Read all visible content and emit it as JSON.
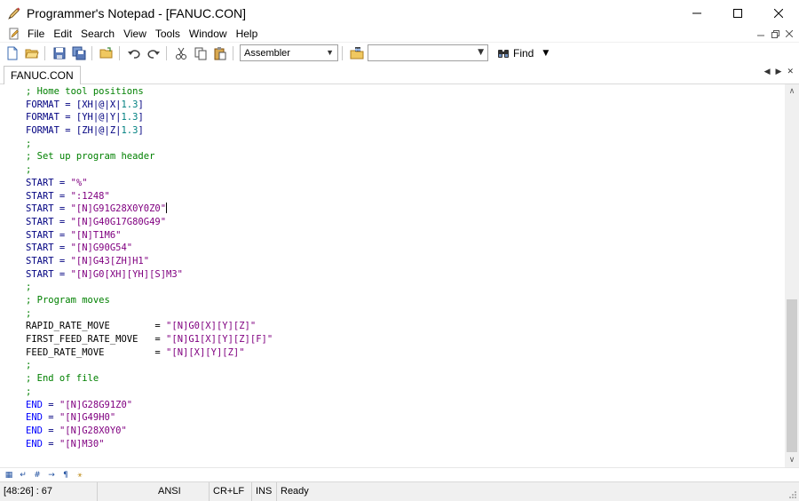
{
  "window": {
    "title": "Programmer's Notepad - [FANUC.CON]"
  },
  "menu": {
    "items": [
      "File",
      "Edit",
      "Search",
      "View",
      "Tools",
      "Window",
      "Help"
    ]
  },
  "toolbar": {
    "scheme_value": "Assembler",
    "find_value": "",
    "find_label": "Find"
  },
  "tabs": [
    {
      "label": "FANUC.CON",
      "active": true
    }
  ],
  "editor": {
    "lines": [
      [
        {
          "t": "; Home tool positions",
          "c": "comment"
        }
      ],
      [
        {
          "t": "FORMAT = [XH|@|X|",
          "c": "plain"
        },
        {
          "t": "1.3",
          "c": "num"
        },
        {
          "t": "]",
          "c": "plain"
        }
      ],
      [
        {
          "t": "FORMAT = [YH|@|Y|",
          "c": "plain"
        },
        {
          "t": "1.3",
          "c": "num"
        },
        {
          "t": "]",
          "c": "plain"
        }
      ],
      [
        {
          "t": "FORMAT = [ZH|@|Z|",
          "c": "plain"
        },
        {
          "t": "1.3",
          "c": "num"
        },
        {
          "t": "]",
          "c": "plain"
        }
      ],
      [
        {
          "t": ";",
          "c": "comment"
        }
      ],
      [
        {
          "t": "; Set up program header",
          "c": "comment"
        }
      ],
      [
        {
          "t": ";",
          "c": "comment"
        }
      ],
      [
        {
          "t": "START = ",
          "c": "plain"
        },
        {
          "t": "\"%\"",
          "c": "str"
        }
      ],
      [
        {
          "t": "START = ",
          "c": "plain"
        },
        {
          "t": "\":1248\"",
          "c": "str"
        }
      ],
      [
        {
          "t": "START = ",
          "c": "plain"
        },
        {
          "t": "\"[N]G91G28X0Y0Z0\"",
          "c": "str"
        },
        {
          "t": "",
          "c": "caret"
        }
      ],
      [
        {
          "t": "START = ",
          "c": "plain"
        },
        {
          "t": "\"[N]G40G17G80G49\"",
          "c": "str"
        }
      ],
      [
        {
          "t": "START = ",
          "c": "plain"
        },
        {
          "t": "\"[N]T1M6\"",
          "c": "str"
        }
      ],
      [
        {
          "t": "START = ",
          "c": "plain"
        },
        {
          "t": "\"[N]G90G54\"",
          "c": "str"
        }
      ],
      [
        {
          "t": "START = ",
          "c": "plain"
        },
        {
          "t": "\"[N]G43[ZH]H1\"",
          "c": "str"
        }
      ],
      [
        {
          "t": "START = ",
          "c": "plain"
        },
        {
          "t": "\"[N]G0[XH][YH][S]M3\"",
          "c": "str"
        }
      ],
      [
        {
          "t": ";",
          "c": "comment"
        }
      ],
      [
        {
          "t": "; Program moves",
          "c": "comment"
        }
      ],
      [
        {
          "t": ";",
          "c": "comment"
        }
      ],
      [
        {
          "t": "RAPID_RATE_MOVE        = ",
          "c": "ident"
        },
        {
          "t": "\"[N]G0[X][Y][Z]\"",
          "c": "str"
        }
      ],
      [
        {
          "t": "FIRST_FEED_RATE_MOVE   = ",
          "c": "ident"
        },
        {
          "t": "\"[N]G1[X][Y][Z][F]\"",
          "c": "str"
        }
      ],
      [
        {
          "t": "FEED_RATE_MOVE         = ",
          "c": "ident"
        },
        {
          "t": "\"[N][X][Y][Z]\"",
          "c": "str"
        }
      ],
      [
        {
          "t": ";",
          "c": "comment"
        }
      ],
      [
        {
          "t": "; End of file",
          "c": "comment"
        }
      ],
      [
        {
          "t": ";",
          "c": "comment"
        }
      ],
      [
        {
          "t": "END",
          "c": "kw"
        },
        {
          "t": " = ",
          "c": "plain"
        },
        {
          "t": "\"[N]G28G91Z0\"",
          "c": "str"
        }
      ],
      [
        {
          "t": "END",
          "c": "kw"
        },
        {
          "t": " = ",
          "c": "plain"
        },
        {
          "t": "\"[N]G49H0\"",
          "c": "str"
        }
      ],
      [
        {
          "t": "END",
          "c": "kw"
        },
        {
          "t": " = ",
          "c": "plain"
        },
        {
          "t": "\"[N]G28X0Y0\"",
          "c": "str"
        }
      ],
      [
        {
          "t": "END",
          "c": "kw"
        },
        {
          "t": " = ",
          "c": "plain"
        },
        {
          "t": "\"[N]M30\"",
          "c": "str"
        }
      ]
    ]
  },
  "status": {
    "position": "[48:26] : 67",
    "encoding": "ANSI",
    "line_endings": "CR+LF",
    "mode": "INS",
    "state": "Ready"
  },
  "colors": {
    "comment": "#008000",
    "string": "#800080",
    "number": "#008080",
    "keyword": "#0000ff",
    "plain": "#000080"
  }
}
